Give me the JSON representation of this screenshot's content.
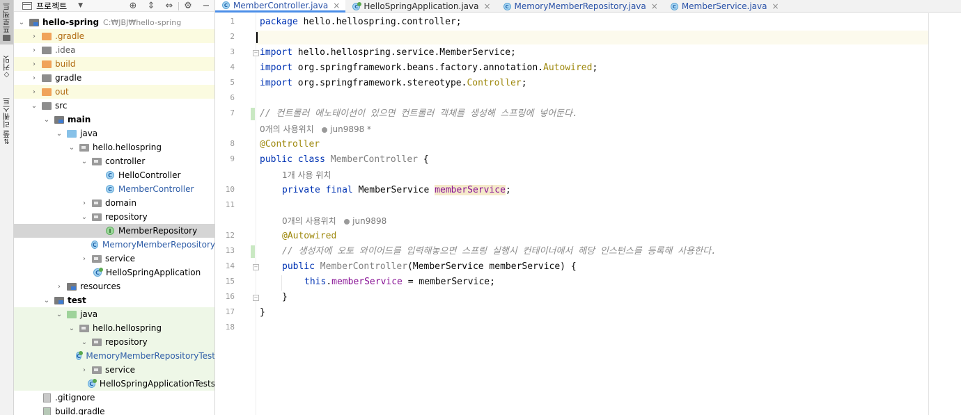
{
  "sidebar_strip": {
    "items": [
      {
        "label": "프로젝트",
        "active": true
      },
      {
        "label": "커밋",
        "active": false
      },
      {
        "label": "풀 리퀘스트",
        "active": false
      }
    ]
  },
  "project_panel": {
    "title": "프로젝트",
    "tree": [
      {
        "label": "hello-spring",
        "path": "C:₩JBJ₩hello-spring"
      },
      {
        "label": ".gradle"
      },
      {
        "label": ".idea"
      },
      {
        "label": "build"
      },
      {
        "label": "gradle"
      },
      {
        "label": "out"
      },
      {
        "label": "src"
      },
      {
        "label": "main"
      },
      {
        "label": "java"
      },
      {
        "label": "hello.hellospring"
      },
      {
        "label": "controller"
      },
      {
        "label": "HelloController"
      },
      {
        "label": "MemberController"
      },
      {
        "label": "domain"
      },
      {
        "label": "repository"
      },
      {
        "label": "MemberRepository"
      },
      {
        "label": "MemoryMemberRepository"
      },
      {
        "label": "service"
      },
      {
        "label": "HelloSpringApplication"
      },
      {
        "label": "resources"
      },
      {
        "label": "test"
      },
      {
        "label": "java"
      },
      {
        "label": "hello.hellospring"
      },
      {
        "label": "repository"
      },
      {
        "label": "MemoryMemberRepositoryTest"
      },
      {
        "label": "service"
      },
      {
        "label": "HelloSpringApplicationTests"
      },
      {
        "label": ".gitignore"
      },
      {
        "label": "build.gradle"
      }
    ]
  },
  "tabs": [
    {
      "label": "MemberController.java",
      "active": true
    },
    {
      "label": "HelloSpringApplication.java",
      "active": false
    },
    {
      "label": "MemoryMemberRepository.java",
      "active": false
    },
    {
      "label": "MemberService.java",
      "active": false
    }
  ],
  "editor": {
    "line_numbers": [
      "1",
      "2",
      "3",
      "4",
      "5",
      "6",
      "7",
      "8",
      "9",
      "10",
      "11",
      "12",
      "13",
      "14",
      "15",
      "16",
      "17",
      "18"
    ],
    "tokens": {
      "package": "package",
      "pkg_name": "hello.hellospring.controller;",
      "import": "import",
      "imp1": "hello.hellospring.service.MemberService;",
      "imp2a": "org.springframework.beans.factory.annotation.",
      "imp2b": "Autowired",
      "imp3a": "org.springframework.stereotype.",
      "imp3b": "Controller",
      "semi": ";",
      "comment1": "// 컨트롤러 에노테이션이 있으면 컨트롤러 객체를 생성해 스프링에 넣어둔다.",
      "ann_controller": "@Controller",
      "public": "public",
      "class": "class",
      "class_name": "MemberController",
      "brace_open": " {",
      "private": "private",
      "final": "final",
      "type_ms": "MemberService",
      "field": "memberService",
      "ann_autowired": "@Autowired",
      "comment2": "// 생성자에 오토 와이어드를 입력해놓으면 스프링 실행시 컨테이너에서 해당 인스턴스를 등록해 사용한다.",
      "ctor_name": "MemberController",
      "ctor_params": "(MemberService memberService) {",
      "this": "this",
      "dot": ".",
      "assign": " = memberService;",
      "close_inner": "}",
      "close_outer": "}"
    },
    "hints": {
      "usages_class": "0개의 사용위치",
      "author_class": "jun9898 *",
      "usages_field": "1개 사용 위치",
      "usages_ctor": "0개의 사용위치",
      "author_ctor": "jun9898"
    }
  },
  "colors": {
    "keyword": "#0033b3",
    "annotation": "#9e880d",
    "comment": "#8c8c8c",
    "field": "#871094",
    "ignored_bg": "#fbfbe0",
    "test_bg": "#eef7e7",
    "selection_bg": "#d5d5d5",
    "tab_accent": "#4b8ee8"
  }
}
